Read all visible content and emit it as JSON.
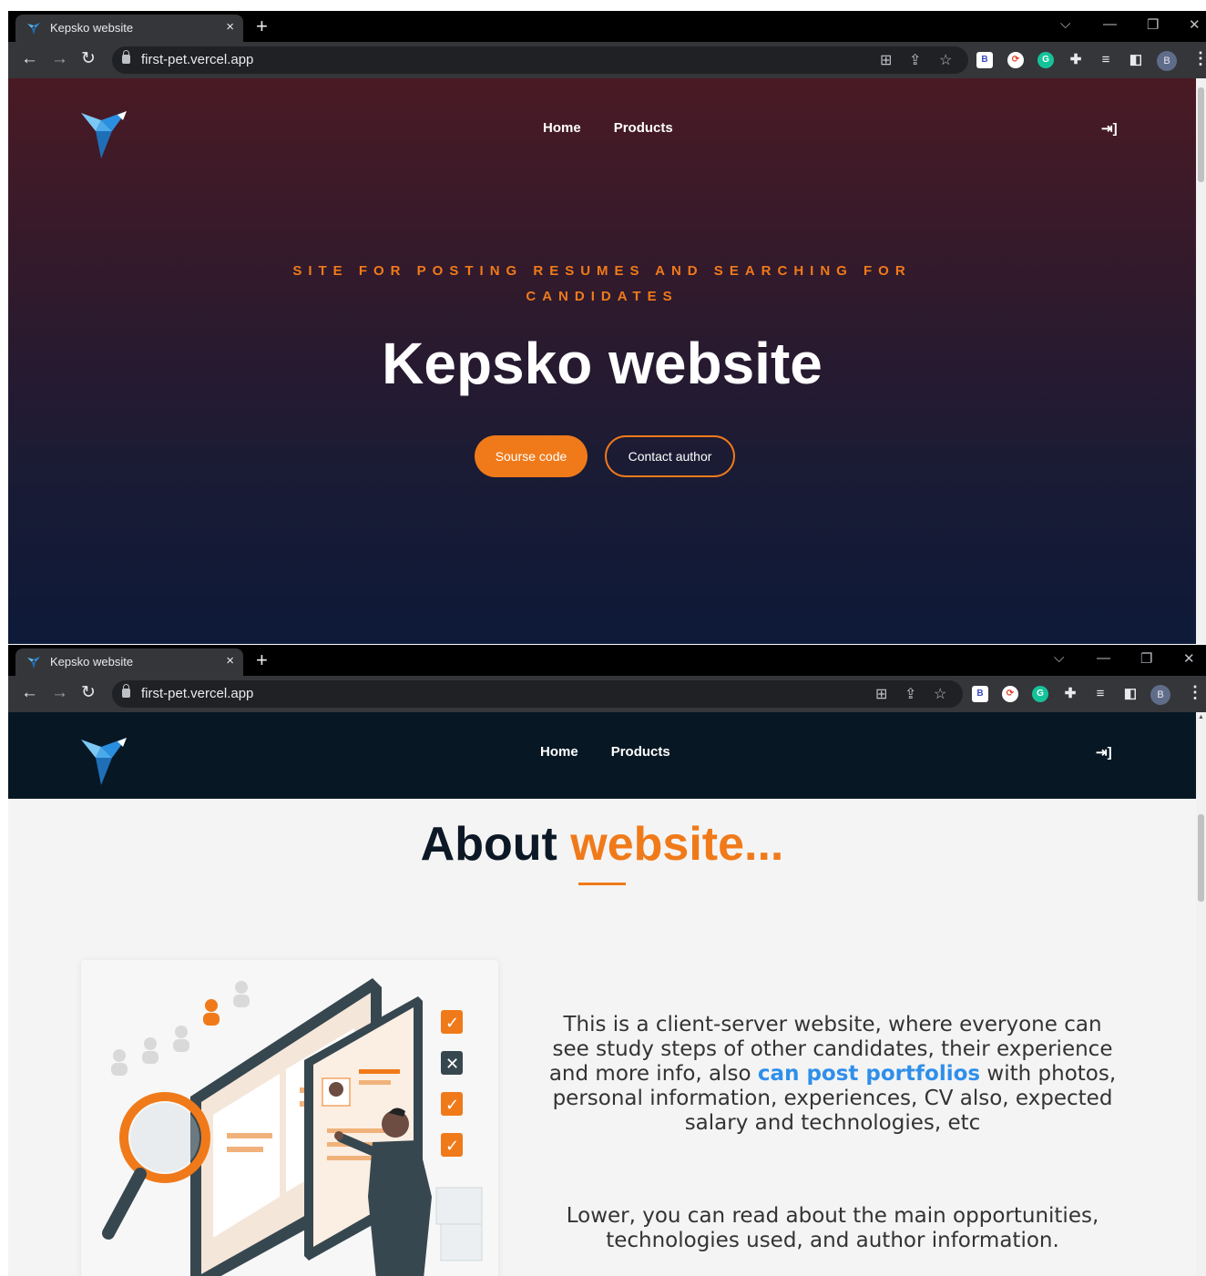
{
  "browser": {
    "tab_title": "Kepsko website",
    "tab_close": "×",
    "new_tab": "+",
    "url": "first-pet.vercel.app",
    "profile_initial": "B",
    "ext_b_label": "B",
    "ext_g_label": "G"
  },
  "site": {
    "nav": {
      "home": "Home",
      "products": "Products"
    },
    "hero": {
      "tagline": "SITE FOR POSTING RESUMES AND SEARCHING FOR CANDIDATES",
      "title": "Kepsko website",
      "source_button": "Sourse code",
      "contact_button": "Contact author"
    },
    "about": {
      "title_main": "About",
      "title_accent": "website...",
      "paragraph1_before": "This is a client-server website, where everyone can see study steps of other candidates, their experience and more info, also ",
      "paragraph1_highlight": "can post portfolios",
      "paragraph1_after": " with photos, personal information, experiences, CV also, expected salary and technologies, etc",
      "paragraph2": "Lower, you can read about the main opportunities, technologies used, and author information."
    }
  },
  "colors": {
    "accent_orange": "#f07a1a",
    "link_blue": "#2f8fea",
    "header_dark": "#071824",
    "logo_blue": "#2a8fe0"
  },
  "icons": {
    "logo": "origami-bird-logo",
    "login": "sign-in-icon",
    "illustration": "resume-search-illustration"
  }
}
